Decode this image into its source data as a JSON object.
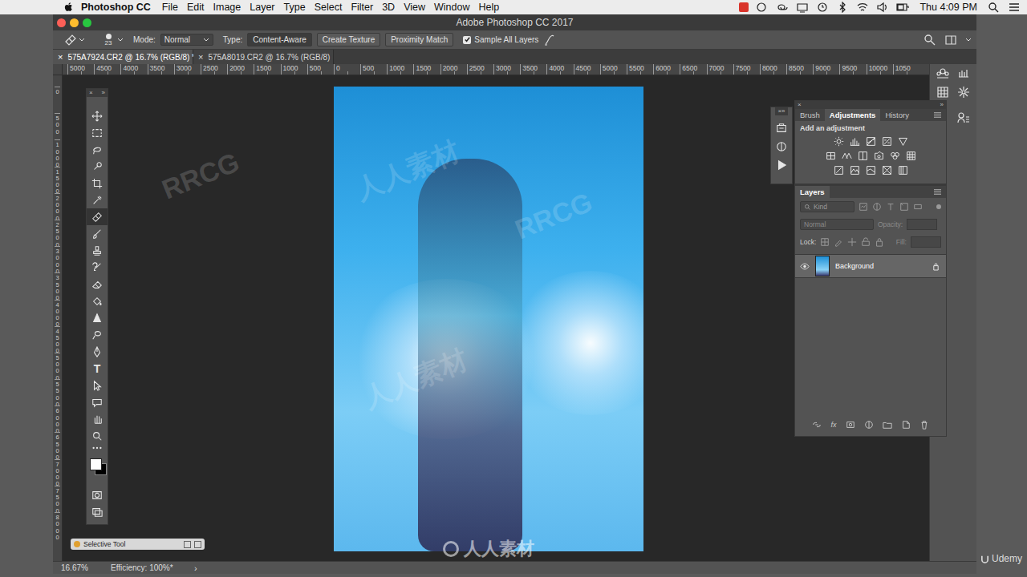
{
  "menubar": {
    "app": "Photoshop CC",
    "items": [
      "File",
      "Edit",
      "Image",
      "Layer",
      "Type",
      "Select",
      "Filter",
      "3D",
      "View",
      "Window",
      "Help"
    ],
    "clock": "Thu 4:09 PM"
  },
  "window": {
    "title": "Adobe Photoshop CC 2017"
  },
  "options": {
    "brush_size": "23",
    "mode_label": "Mode:",
    "mode": "Normal",
    "type_label": "Type:",
    "types": [
      {
        "label": "Content-Aware",
        "selected": true
      },
      {
        "label": "Create Texture",
        "selected": false
      },
      {
        "label": "Proximity Match",
        "selected": false
      }
    ],
    "sample_all": {
      "label": "Sample All Layers",
      "checked": true
    }
  },
  "documents": [
    {
      "label": "575A7924.CR2 @ 16.7% (RGB/8) *",
      "selected": true
    },
    {
      "label": "575A8019.CR2 @ 16.7% (RGB/8)",
      "selected": false
    }
  ],
  "glyphs": {
    "close": "×",
    "collapse": "»",
    "status_arrow": "›"
  },
  "rulers": {
    "horizontal": [
      "5000",
      "4500",
      "4000",
      "3500",
      "3000",
      "2500",
      "2000",
      "1500",
      "1000",
      "500",
      "0",
      "500",
      "1000",
      "1500",
      "2000",
      "2500",
      "3000",
      "3500",
      "4000",
      "4500",
      "5000",
      "5500",
      "6000",
      "6500",
      "7000",
      "7500",
      "8000",
      "8500",
      "9000",
      "9500",
      "10000",
      "1050"
    ],
    "vertical": [
      "0",
      "500",
      "1000",
      "1500",
      "2000",
      "2500",
      "3000",
      "3500",
      "4000",
      "4500",
      "5000",
      "5500",
      "6000",
      "6500",
      "7000",
      "7500",
      "8000"
    ]
  },
  "tools": [
    {
      "selected": false
    },
    {
      "selected": false
    },
    {
      "selected": false
    },
    {
      "selected": false
    },
    {
      "selected": false
    },
    {
      "selected": false
    },
    {
      "selected": true
    },
    {
      "selected": false
    },
    {
      "selected": false
    },
    {
      "selected": false
    },
    {
      "selected": false
    },
    {
      "selected": false
    },
    {
      "selected": false
    },
    {
      "selected": false
    },
    {
      "selected": false
    },
    {
      "selected": false,
      "glyph": "T"
    },
    {
      "selected": false
    },
    {
      "selected": false
    },
    {
      "selected": false
    },
    {
      "selected": false
    }
  ],
  "adjustments_panel": {
    "tabs": [
      {
        "label": "Brush",
        "selected": false
      },
      {
        "label": "Adjustments",
        "selected": true
      },
      {
        "label": "History",
        "selected": false
      }
    ],
    "title": "Add an adjustment"
  },
  "layers_panel": {
    "title": "Layers",
    "filter": "Kind",
    "blend": {
      "value": "Normal",
      "disabled": true
    },
    "opacity": {
      "label": "Opacity:",
      "disabled": true
    },
    "lock_label": "Lock:",
    "fill": {
      "label": "Fill:",
      "disabled": true
    },
    "fx": "fx",
    "layers": [
      {
        "name": "Background",
        "visible": true,
        "locked": true,
        "selected": true
      }
    ]
  },
  "floating_tool": {
    "title": "Selective Tool"
  },
  "status_bar": {
    "zoom": "16.67%",
    "info": "Efficiency: 100%*"
  },
  "watermarks": {
    "marks": [
      "RRCG",
      "人人素材",
      "RRCG",
      "人人素材"
    ],
    "logo": "人人素材",
    "brand": "Udemy"
  }
}
